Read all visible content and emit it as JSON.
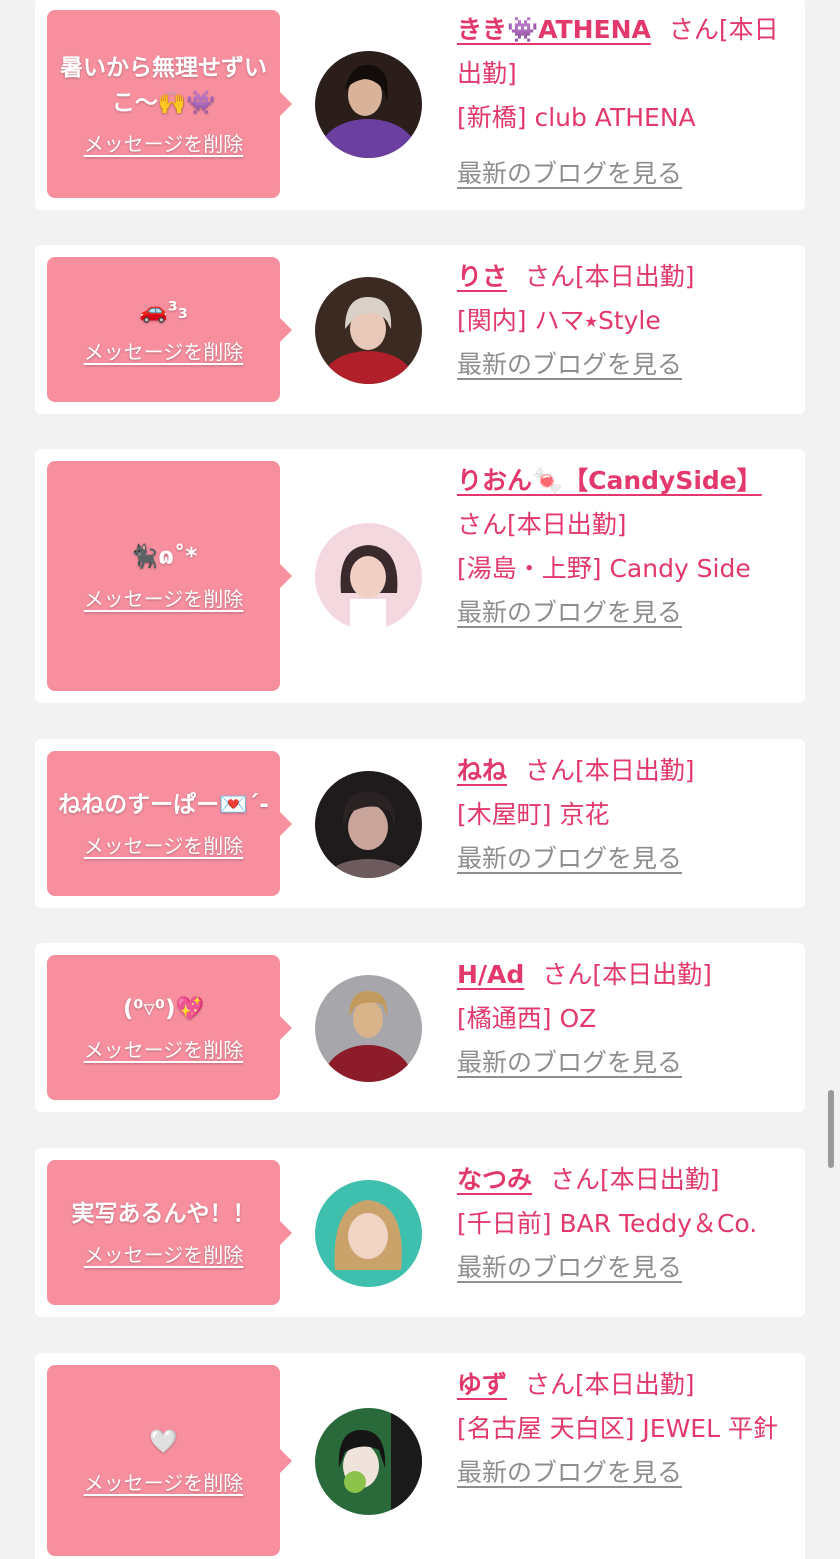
{
  "delete_label": "メッセージを削除",
  "blog_label": "最新のブログを見る",
  "cards": [
    {
      "message": "暑いから無理せずいこ〜🙌👾",
      "name": "きき👾ATHENA",
      "suffix": "さん[本日出勤]",
      "shop": "[新橋] club ATHENA",
      "avatar_colors": [
        "#2a1d1a",
        "#6b3fa0",
        "#d8b39a"
      ]
    },
    {
      "message": "🚗³₃",
      "name": "りさ",
      "suffix": "さん[本日出勤]",
      "shop": "[関内] ハマ⭑Style",
      "avatar_colors": [
        "#3b2a22",
        "#b01f2a",
        "#e8c8b8"
      ]
    },
    {
      "message": "🐈‍⬛ɷ˚*",
      "name": "りおん🍬【CandySide】",
      "suffix": "さん[本日出勤]",
      "shop": "[湯島・上野] Candy Side",
      "avatar_colors": [
        "#f3d9df",
        "#3a2a2e",
        "#f1cfc3"
      ]
    },
    {
      "message": "ねねのすーぱー💌´-",
      "name": "ねね",
      "suffix": "さん[本日出勤]",
      "shop": "[木屋町] 京花",
      "avatar_colors": [
        "#1f1a1c",
        "#c8a49a",
        "#6e5b5e"
      ]
    },
    {
      "message": "(⁰▿⁰)💖",
      "name": "H/Ad",
      "suffix": "さん[本日出勤]",
      "shop": "[橘通西] OZ",
      "avatar_colors": [
        "#a7a7ab",
        "#8d1c2a",
        "#d9b48b"
      ]
    },
    {
      "message": "実写あるんや！！",
      "name": "なつみ",
      "suffix": "さん[本日出勤]",
      "shop": "[千日前] BAR Teddy＆Co.",
      "avatar_colors": [
        "#3fbfae",
        "#c9a36a",
        "#f0d4c4"
      ]
    },
    {
      "message": "🤍",
      "name": "ゆず",
      "suffix": "さん[本日出勤]",
      "shop": "[名古屋 天白区] JEWEL 平針",
      "avatar_colors": [
        "#2a6a3a",
        "#1a1a1a",
        "#8ac24a"
      ]
    }
  ]
}
